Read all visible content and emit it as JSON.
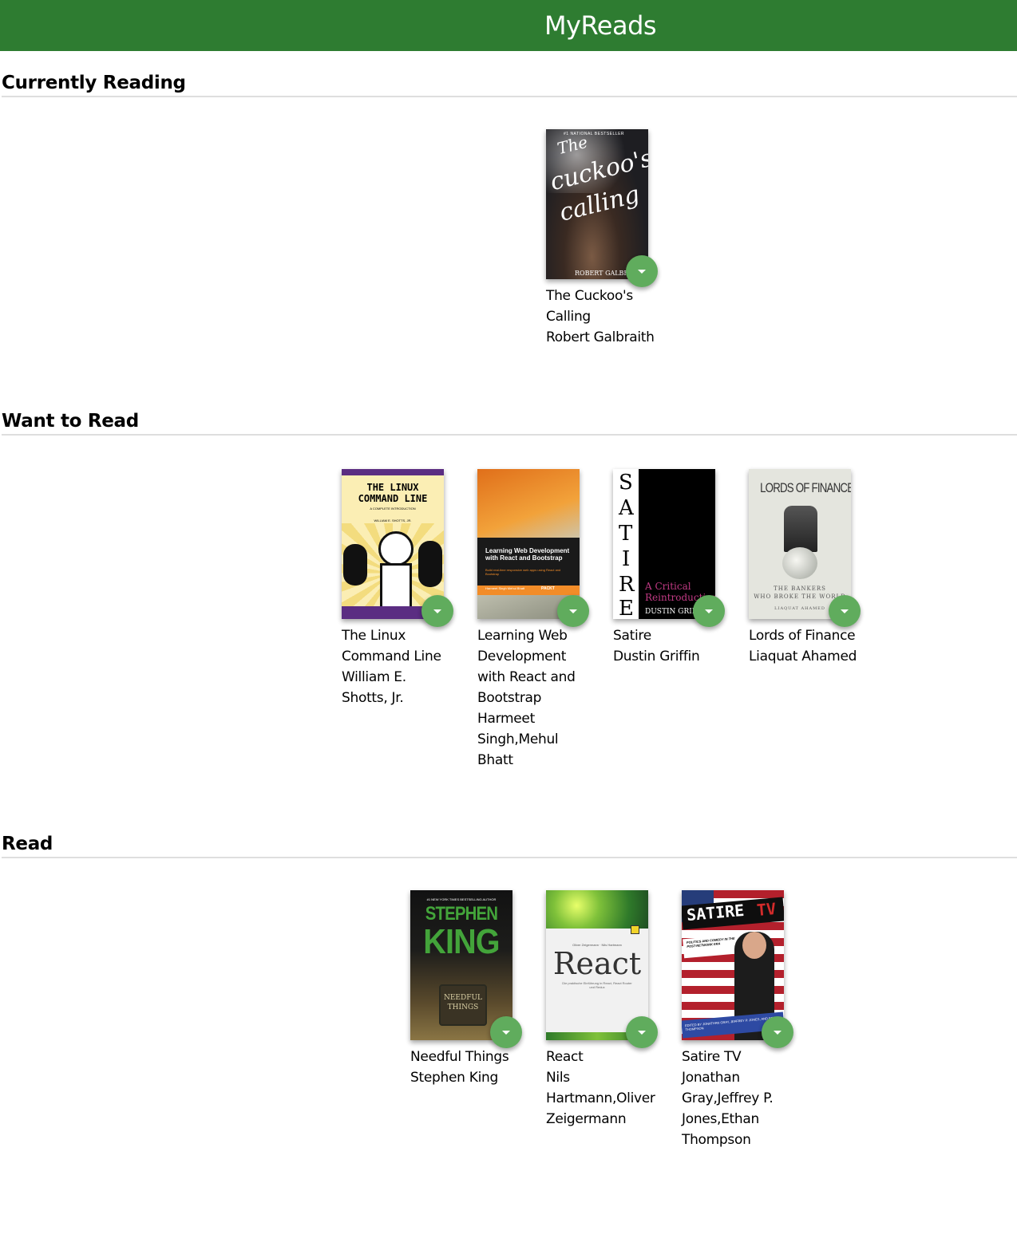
{
  "app": {
    "title": "MyReads"
  },
  "shelves": [
    {
      "title": "Currently Reading",
      "books": [
        {
          "title": "The Cuckoo's Calling",
          "authors": "Robert Galbraith",
          "cover": {
            "line1": "The",
            "line2": "cuckoo's",
            "line3": "calling",
            "author": "ROBERT GALBRAITH",
            "top": "#1 NATIONAL BESTSELLER"
          }
        }
      ]
    },
    {
      "title": "Want to Read",
      "books": [
        {
          "title": "The Linux Command Line",
          "authors": "William E. Shotts, Jr.",
          "cover": {
            "line1": "THE LINUX",
            "line2": "COMMAND LINE",
            "sub": "A COMPLETE INTRODUCTION",
            "author": "WILLIAM E. SHOTTS, JR."
          }
        },
        {
          "title": "Learning Web Development with React and Bootstrap",
          "authors": "Harmeet Singh,Mehul Bhatt",
          "cover": {
            "line1": "Learning Web Development",
            "line2": "with React and Bootstrap",
            "sub": "Build real-time responsive web apps using React and Bootstrap",
            "author": "Harmeet Singh Mehul Bhatt",
            "publisher": "PACKT"
          }
        },
        {
          "title": "Satire",
          "authors": "Dustin Griffin",
          "cover": {
            "letters": [
              "S",
              "A",
              "T",
              "I",
              "R",
              "E"
            ],
            "line1": "A Critical",
            "line2": "Reintroduction",
            "author": "DUSTIN GRIFFIN"
          }
        },
        {
          "title": "Lords of Finance",
          "authors": "Liaquat Ahamed",
          "cover": {
            "line1": "LORDS OF FINANCE",
            "line2": "THE BANKERS",
            "line3": "WHO BROKE THE WORLD",
            "author": "LIAQUAT AHAMED"
          }
        }
      ]
    },
    {
      "title": "Read",
      "books": [
        {
          "title": "Needful Things",
          "authors": "Stephen King",
          "cover": {
            "top": "#1 NEW YORK TIMES BESTSELLING AUTHOR",
            "line1": "STEPHEN",
            "line2": "KING",
            "sign1": "NEEDFUL",
            "sign2": "THINGS"
          }
        },
        {
          "title": "React",
          "authors": "Nils Hartmann,Oliver Zeigermann",
          "cover": {
            "author": "Oliver Zeigermann · Nils Hartmann",
            "line1": "React",
            "sub": "Die praktische Einführung in React, React Router und Redux"
          }
        },
        {
          "title": "Satire TV",
          "authors": "Jonathan Gray,Jeffrey P. Jones,Ethan Thompson",
          "cover": {
            "line1": "SATIRE",
            "line2": "TV",
            "sub": "POLITICS AND COMEDY IN THE POST-NETWORK ERA",
            "author": "EDITED BY JONATHAN GRAY, JEFFREY P. JONES, AND ETHAN THOMPSON"
          }
        }
      ]
    }
  ]
}
